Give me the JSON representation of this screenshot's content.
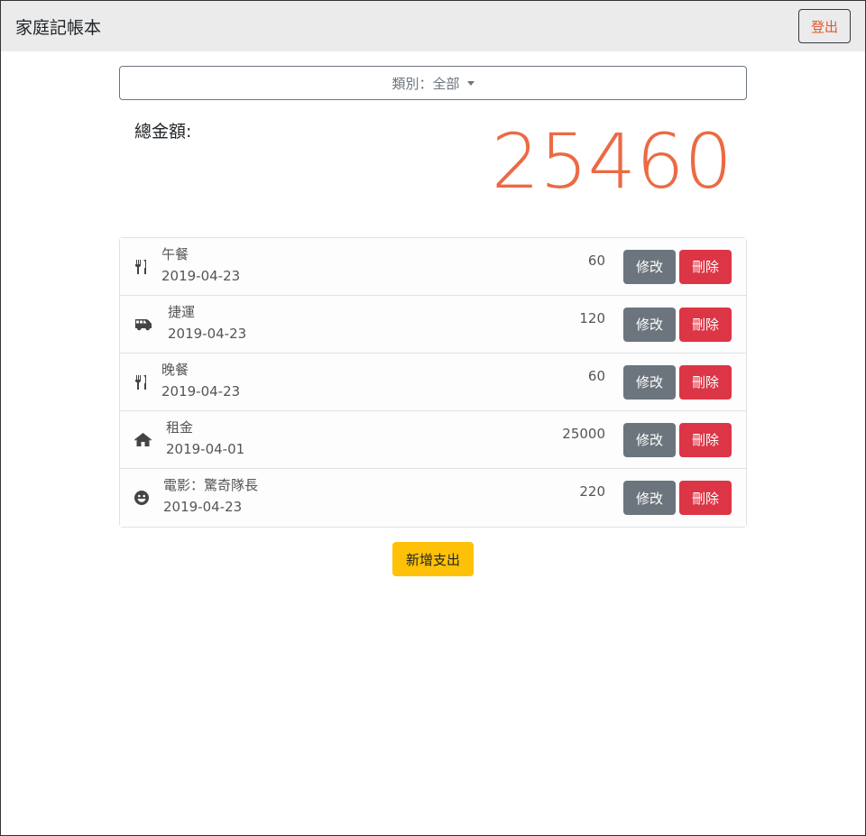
{
  "navbar": {
    "brand": "家庭記帳本",
    "logout_label": "登出",
    "logout_color": "#e4572e"
  },
  "filter": {
    "category_label": "類別：全部"
  },
  "summary": {
    "label": "總金額:",
    "total": "25460",
    "total_color": "#ec6a43"
  },
  "items": [
    {
      "icon": "utensils-icon",
      "name": "午餐",
      "date": "2019-04-23",
      "amount": "60",
      "edit_label": "修改",
      "delete_label": "刪除"
    },
    {
      "icon": "shuttle-van-icon",
      "name": "捷運",
      "date": "2019-04-23",
      "amount": "120",
      "edit_label": "修改",
      "delete_label": "刪除"
    },
    {
      "icon": "utensils-icon",
      "name": "晚餐",
      "date": "2019-04-23",
      "amount": "60",
      "edit_label": "修改",
      "delete_label": "刪除"
    },
    {
      "icon": "home-icon",
      "name": "租金",
      "date": "2019-04-01",
      "amount": "25000",
      "edit_label": "修改",
      "delete_label": "刪除"
    },
    {
      "icon": "grin-icon",
      "name": "電影：驚奇隊長",
      "date": "2019-04-23",
      "amount": "220",
      "edit_label": "修改",
      "delete_label": "刪除"
    }
  ],
  "add_button_label": "新增支出",
  "colors": {
    "edit": "#6c757d",
    "delete": "#dc3545",
    "add": "#ffc107"
  }
}
